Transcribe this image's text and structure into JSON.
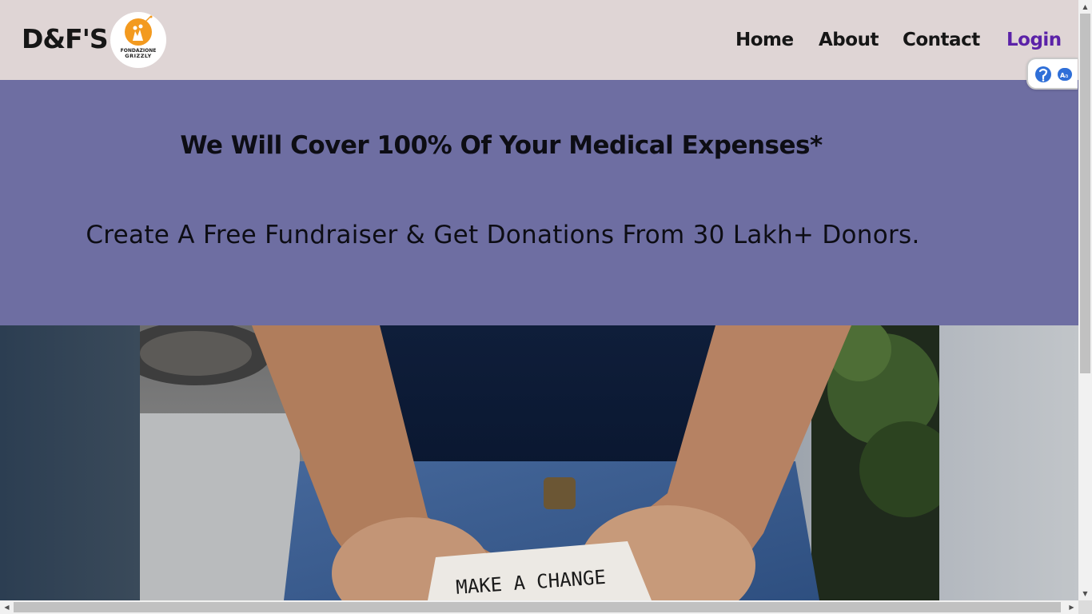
{
  "header": {
    "brand": "D&F'S",
    "logo": {
      "line1": "FONDAZIONE",
      "line2": "GRIZZLY",
      "accent": "#f39a1f"
    },
    "nav": [
      {
        "label": "Home"
      },
      {
        "label": "About"
      },
      {
        "label": "Contact"
      },
      {
        "label": "Login",
        "color": "#5b22a8"
      }
    ]
  },
  "widget": {
    "icons": [
      "accessibility-icon",
      "translate-icon"
    ]
  },
  "hero": {
    "title": "We Will Cover 100% Of Your Medical Expenses*",
    "subtitle": "Create A Free Fundraiser & Get Donations From 30 Lakh+ Donors.",
    "background": "#6e6ea2"
  },
  "photo": {
    "note_text": "MAKE A CHANGE"
  },
  "colors": {
    "header_bg": "#dfd5d5",
    "accent_purple": "#5b22a8"
  }
}
